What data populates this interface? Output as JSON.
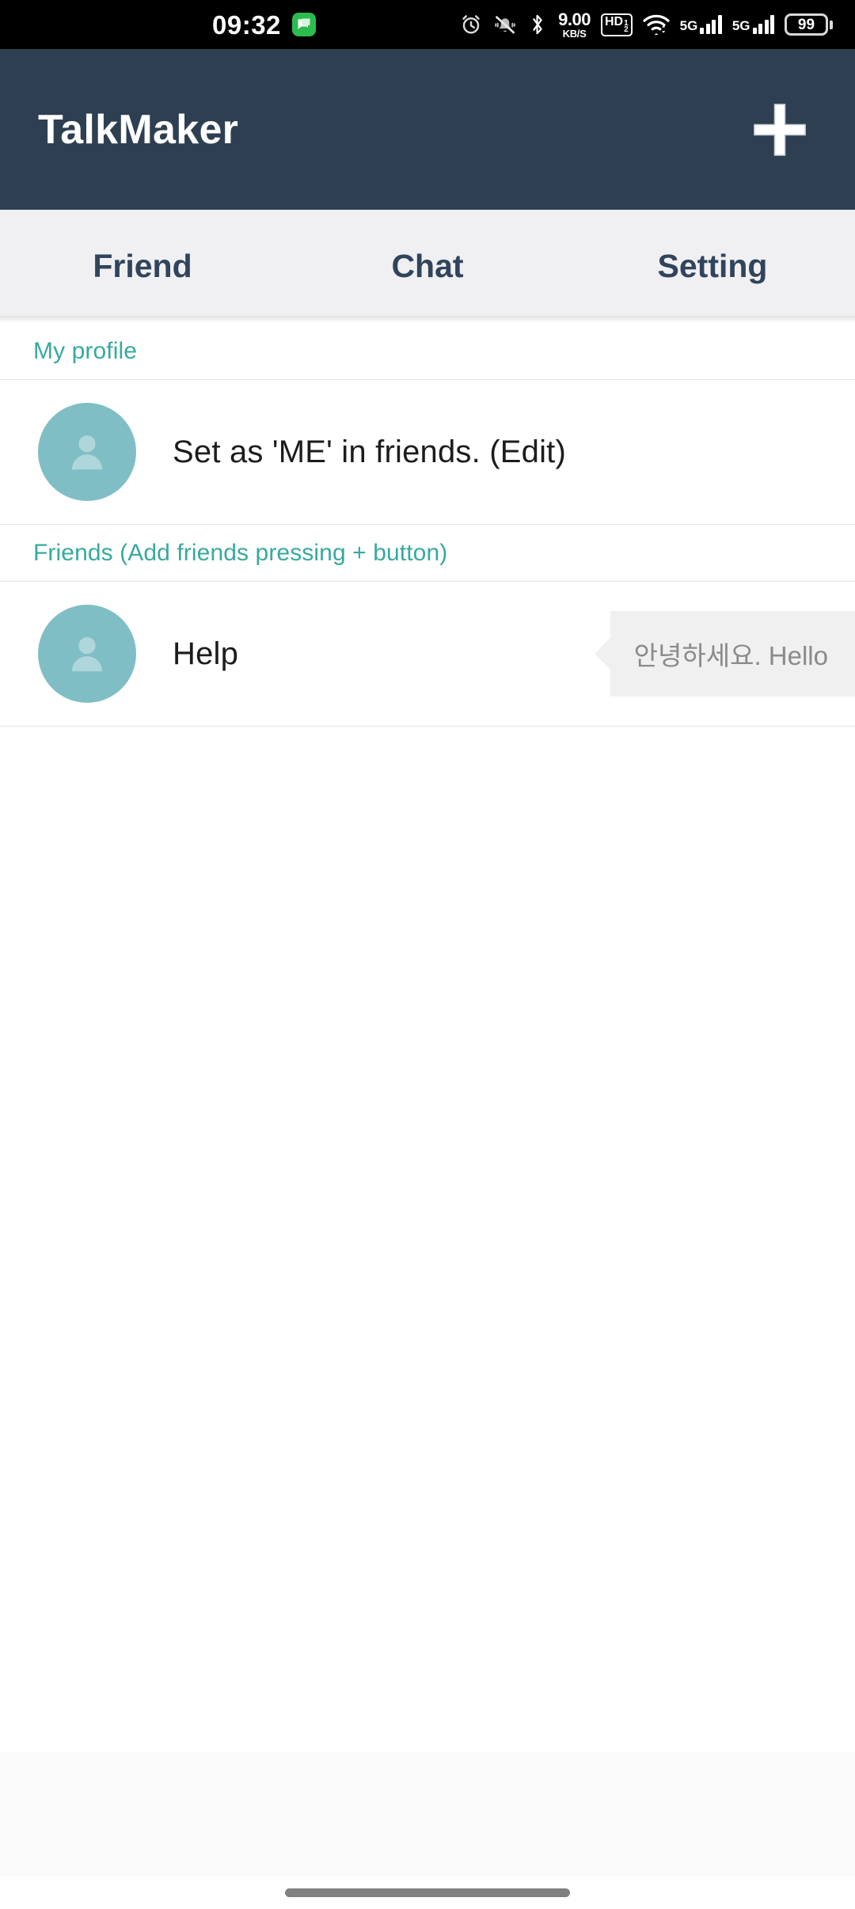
{
  "status_bar": {
    "time": "09:32",
    "message_icon": "message-icon",
    "alarm_icon": "alarm-icon",
    "mute_icon": "bell-muted-icon",
    "bluetooth_icon": "bluetooth-icon",
    "network_speed_value": "9.00",
    "network_speed_unit": "KB/S",
    "hd_badge": "HD",
    "hd_badge_sup": "1",
    "hd_badge_sub": "2",
    "wifi_icon": "wifi-icon",
    "sim1_label": "5G",
    "sim2_label": "5G",
    "battery_level": "99",
    "bg_color": "#000000",
    "fg_color": "#ffffff"
  },
  "app_bar": {
    "title": "TalkMaker",
    "add_button_name": "plus-icon",
    "bg_color": "#2F3F52",
    "title_color": "#ffffff"
  },
  "tabs": {
    "active_index": 0,
    "indicator_color": "#45312F",
    "bg_color": "#F0F0F2",
    "label_color": "#30445C",
    "items": [
      {
        "label": "Friend"
      },
      {
        "label": "Chat"
      },
      {
        "label": "Setting"
      }
    ]
  },
  "sections": [
    {
      "header": "My profile",
      "header_color": "#38A99E",
      "rows": [
        {
          "avatar": "person-avatar",
          "name": "Set as 'ME' in friends. (Edit)",
          "bubble": null
        }
      ]
    },
    {
      "header": "Friends (Add friends pressing + button)",
      "header_color": "#38A99E",
      "rows": [
        {
          "avatar": "person-avatar",
          "name": "Help",
          "bubble": "안녕하세요. Hello"
        }
      ]
    }
  ],
  "colors": {
    "avatar_bg": "#7FBEC4",
    "avatar_fg": "#AFD7DB",
    "bubble_bg": "#F0F0F0",
    "bubble_text": "#8A8A8A",
    "divider": "#e6e6e6",
    "bottom_band": "#FAFAFA",
    "nav_pill": "#808080"
  },
  "navigation": {
    "gesture_pill": "gesture-handle"
  }
}
